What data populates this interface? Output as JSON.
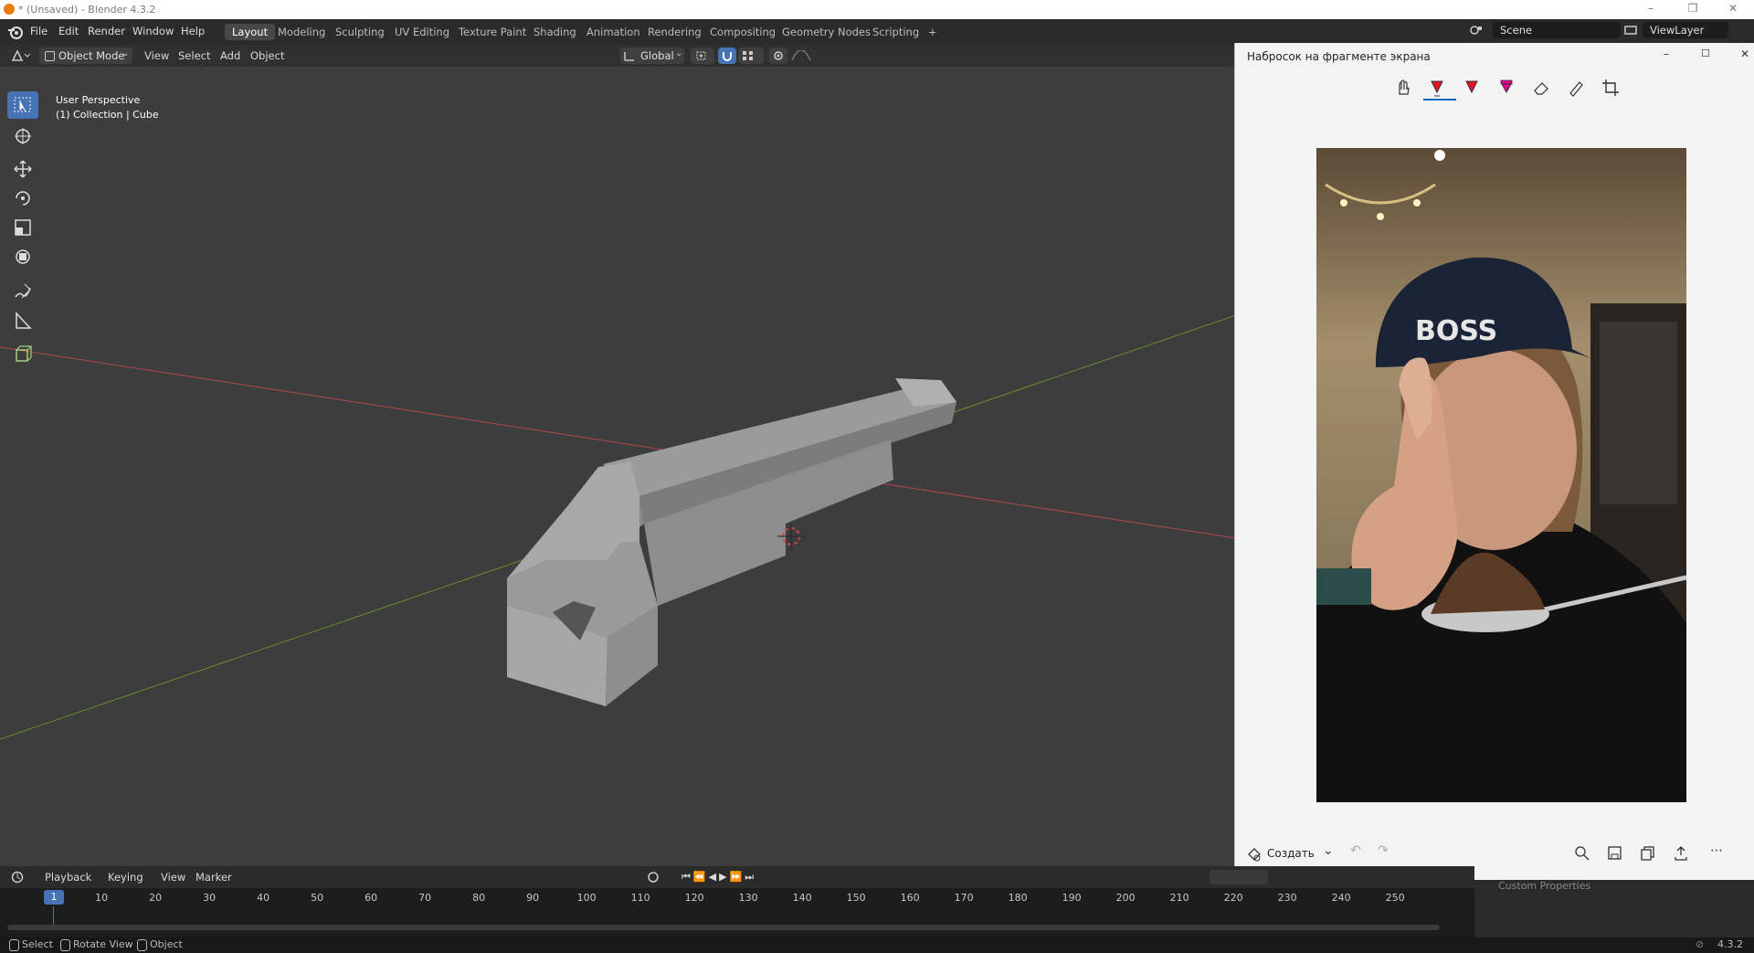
{
  "window": {
    "title": "* (Unsaved) - Blender 4.3.2",
    "controls": [
      "–",
      "❐",
      "✕"
    ]
  },
  "menubar": {
    "items": [
      "File",
      "Edit",
      "Render",
      "Window",
      "Help"
    ],
    "workspaces": [
      "Layout",
      "Modeling",
      "Sculpting",
      "UV Editing",
      "Texture Paint",
      "Shading",
      "Animation",
      "Rendering",
      "Compositing",
      "Geometry Nodes",
      "Scripting",
      "+"
    ],
    "active_workspace": "Layout",
    "scene": "Scene",
    "view_layer": "ViewLayer"
  },
  "viewport_header": {
    "mode": "Object Mode",
    "menus": [
      "View",
      "Select",
      "Add",
      "Object"
    ],
    "transform_orientation": "Global"
  },
  "viewport": {
    "perspective": "User Perspective",
    "collection": "(1) Collection | Cube"
  },
  "snip": {
    "title": "Набросок на фрагменте экрана",
    "create_label": "Создать",
    "more": "⋯",
    "photo_cap_text": "BOSS"
  },
  "timeline": {
    "menus": [
      "Playback",
      "Keying",
      "View",
      "Marker"
    ],
    "current_frame": "1",
    "ticks": [
      "10",
      "20",
      "30",
      "40",
      "50",
      "60",
      "70",
      "80",
      "90",
      "100",
      "110",
      "120",
      "130",
      "140",
      "150",
      "160",
      "170",
      "180",
      "190",
      "200",
      "210",
      "220",
      "230",
      "240",
      "250"
    ],
    "partial_label": "Custom Properties"
  },
  "statusbar": {
    "select": "Select",
    "rotate": "Rotate View",
    "object": "Object",
    "version": "4.3.2"
  },
  "colors": {
    "accent": "#4772b3",
    "x_axis": "#b04848",
    "y_axis": "#6a8a2e"
  }
}
